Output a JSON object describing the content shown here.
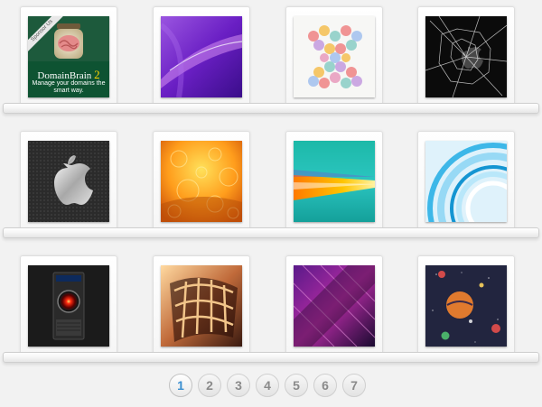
{
  "tiles": [
    {
      "name": "domainbrain-sponsor",
      "ribbon": "Sponsor Us",
      "title": "DomainBrain",
      "version": "2",
      "tagline": "Manage your domains the smart way."
    },
    {
      "name": "purple-abstract"
    },
    {
      "name": "pastel-hexagon-pattern"
    },
    {
      "name": "broken-glass-apple"
    },
    {
      "name": "silver-apple-logo"
    },
    {
      "name": "orange-bokeh"
    },
    {
      "name": "teal-orange-streak"
    },
    {
      "name": "blue-circles"
    },
    {
      "name": "hal-9000"
    },
    {
      "name": "caged-window"
    },
    {
      "name": "purple-streaks"
    },
    {
      "name": "space-planets"
    }
  ],
  "pagination": {
    "pages": [
      "1",
      "2",
      "3",
      "4",
      "5",
      "6",
      "7"
    ],
    "current": "1",
    "active_color": "#3b8fd0"
  }
}
